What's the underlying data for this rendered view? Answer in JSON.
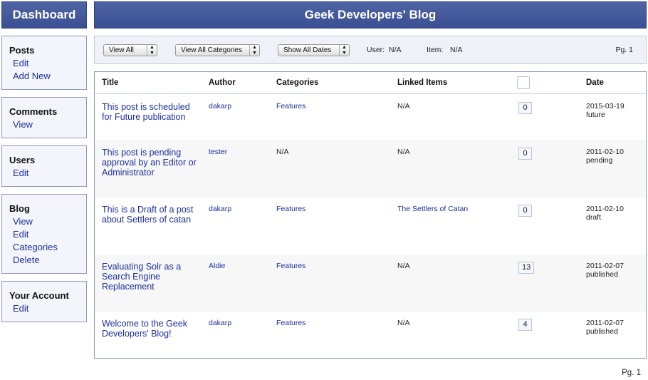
{
  "header": {
    "dashboard": "Dashboard",
    "blog_title": "Geek Developers' Blog"
  },
  "sidebar": {
    "posts": {
      "heading": "Posts",
      "items": [
        "Edit",
        "Add New"
      ]
    },
    "comments": {
      "heading": "Comments",
      "items": [
        "View"
      ]
    },
    "users": {
      "heading": "Users",
      "items": [
        "Edit"
      ]
    },
    "blog": {
      "heading": "Blog",
      "items": [
        "View",
        "Edit",
        "Categories",
        "Delete"
      ]
    },
    "account": {
      "heading": "Your Account",
      "items": [
        "Edit"
      ]
    }
  },
  "filters": {
    "view": "View All",
    "categories": "View All Categories",
    "dates": "Show All Dates",
    "user_label": "User:",
    "user_value": "N/A",
    "item_label": "Item:",
    "item_value": "N/A",
    "page": "Pg. 1"
  },
  "table": {
    "headers": {
      "title": "Title",
      "author": "Author",
      "categories": "Categories",
      "linked": "Linked Items",
      "date": "Date"
    },
    "rows": [
      {
        "title": "This post is scheduled for Future publication",
        "author": "dakarp",
        "categories": "Features",
        "linked": "N/A",
        "comments": "0",
        "date": "2015-03-19",
        "status": "future"
      },
      {
        "title": "This post is pending approval by an Editor or Administrator",
        "author": "tester",
        "categories": "N/A",
        "linked": "N/A",
        "comments": "0",
        "date": "2011-02-10",
        "status": "pending"
      },
      {
        "title": "This is a Draft of a post about Settlers of catan",
        "author": "dakarp",
        "categories": "Features",
        "linked": "The Settlers of Catan",
        "comments": "0",
        "date": "2011-02-10",
        "status": "draft"
      },
      {
        "title": "Evaluating Solr as a Search Engine Replacement",
        "author": "Aldie",
        "categories": "Features",
        "linked": "N/A",
        "comments": "13",
        "date": "2011-02-07",
        "status": "published"
      },
      {
        "title": "Welcome to the Geek Developers' Blog!",
        "author": "dakarp",
        "categories": "Features",
        "linked": "N/A",
        "comments": "4",
        "date": "2011-02-07",
        "status": "published"
      }
    ]
  },
  "footer": {
    "page": "Pg. 1"
  }
}
